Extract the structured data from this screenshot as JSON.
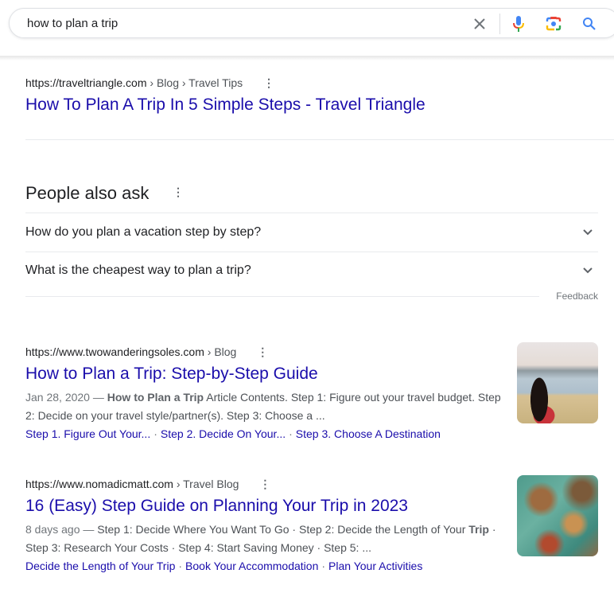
{
  "search": {
    "query": "how to plan a trip",
    "icons": [
      "clear-icon",
      "mic-icon",
      "lens-icon",
      "search-icon"
    ]
  },
  "result_top": {
    "url": "https://traveltriangle.com",
    "breadcrumb": " › Blog › Travel Tips",
    "title": "How To Plan A Trip In 5 Simple Steps - Travel Triangle"
  },
  "people_also_ask": {
    "heading": "People also ask",
    "questions": [
      "How do you plan a vacation step by step?",
      "What is the cheapest way to plan a trip?"
    ],
    "feedback": "Feedback"
  },
  "results": [
    {
      "url": "https://www.twowanderingsoles.com",
      "breadcrumb": " › Blog",
      "title": "How to Plan a Trip: Step-by-Step Guide",
      "date": "Jan 28, 2020",
      "dash": " — ",
      "snippet_bold": "How to Plan a Trip",
      "snippet_rest": " Article Contents. Step 1: Figure out your travel budget. Step 2: Decide on your travel style/partner(s). Step 3: Choose a ...",
      "sitelinks": [
        "Step 1. Figure Out Your...",
        "Step 2. Decide On Your...",
        "Step 3. Choose A Destination"
      ],
      "thumbnail": "woman-overlooking-river-photo"
    },
    {
      "url": "https://www.nomadicmatt.com",
      "breadcrumb": " › Travel Blog",
      "title": "16 (Easy) Step Guide on Planning Your Trip in 2023",
      "date": "8 days ago",
      "dash": " — ",
      "snippet_pre": "Step 1: Decide Where You Want To Go · Step 2: Decide the Length of Your ",
      "snippet_bold": "Trip",
      "snippet_rest": " · Step 3: Research Your Costs · Step 4: Start Saving Money · Step 5: ...",
      "sitelinks": [
        "Decide the Length of Your Trip",
        "Book Your Accommodation",
        "Plan Your Activities"
      ],
      "thumbnail": "world-map-photo"
    }
  ],
  "sitelink_separator": "·",
  "kebab_glyph": "⋮"
}
